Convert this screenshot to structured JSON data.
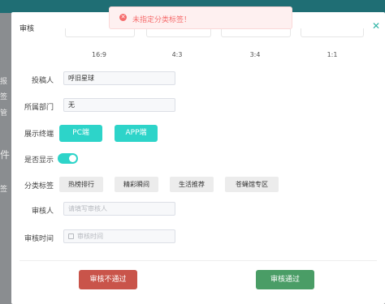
{
  "background": {
    "fragments": [
      "报",
      "签",
      "管",
      "件",
      "签"
    ]
  },
  "modal": {
    "title": "审核",
    "close_icon": "close-icon"
  },
  "toast": {
    "message": "未指定分类标签！",
    "icon": "error-circle-icon",
    "color": "#f56c6c"
  },
  "ratios": [
    "16:9",
    "4:3",
    "3:4",
    "1:1"
  ],
  "form": {
    "contributor": {
      "label": "投稿人",
      "value": "呼旧星球"
    },
    "department": {
      "label": "所属部门",
      "value": "无"
    },
    "terminal": {
      "label": "展示终端",
      "options": [
        "PC端",
        "APP端"
      ]
    },
    "display": {
      "label": "是否显示",
      "enabled": true
    },
    "tags": {
      "label": "分类标签",
      "options": [
        "热榜排行",
        "精彩瞬间",
        "生活推荐",
        "苍蝇馆专区"
      ]
    },
    "reviewer": {
      "label": "审核人",
      "placeholder": "请填写审核人"
    },
    "review_time": {
      "label": "审核时间",
      "placeholder": "审核时间"
    }
  },
  "actions": {
    "reject": "审核不通过",
    "approve": "审核通过"
  },
  "colors": {
    "accent": "#2dd4c9",
    "reject": "#c9544a",
    "approve": "#4a9d66"
  }
}
